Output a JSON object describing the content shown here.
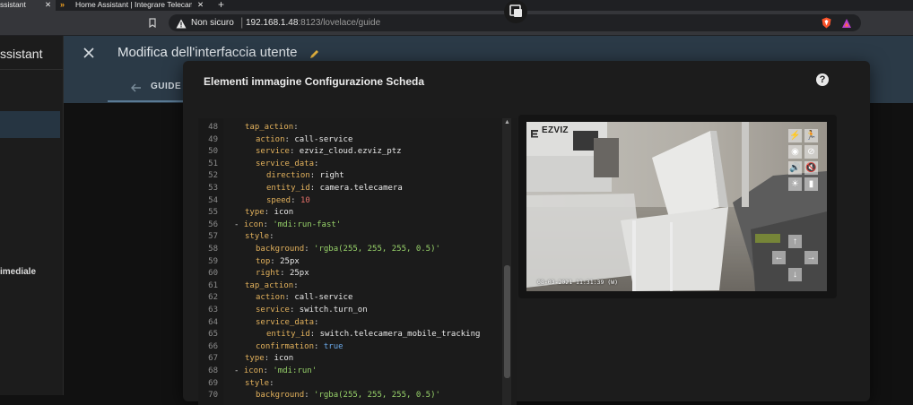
{
  "browser": {
    "tabs": [
      {
        "label": "ssistant",
        "close": "✕"
      },
      {
        "label": "Home Assistant | Integrare Telecamere",
        "close": "✕"
      }
    ],
    "new_tab": "+",
    "security_label": "Non sicuro",
    "url_host": "192.168.1.48",
    "url_path": ":8123/lovelace/guide"
  },
  "ha": {
    "sidebar_title": "ssistant",
    "sidebar_item": "imediale",
    "header_title": "Modifica dell'interfaccia utente",
    "tab_label": "GUIDE"
  },
  "dialog": {
    "title": "Elementi immagine Configurazione Scheda",
    "help": "?"
  },
  "editor": {
    "lines": [
      {
        "n": "48",
        "i": 2,
        "segs": [
          [
            "k",
            "tap_action"
          ],
          [
            "p",
            ":"
          ]
        ]
      },
      {
        "n": "49",
        "i": 3,
        "segs": [
          [
            "k",
            "action"
          ],
          [
            "p",
            ": "
          ],
          [
            "v",
            "call-service"
          ]
        ]
      },
      {
        "n": "50",
        "i": 3,
        "segs": [
          [
            "k",
            "service"
          ],
          [
            "p",
            ": "
          ],
          [
            "v",
            "ezviz_cloud.ezviz_ptz"
          ]
        ]
      },
      {
        "n": "51",
        "i": 3,
        "segs": [
          [
            "k",
            "service_data"
          ],
          [
            "p",
            ":"
          ]
        ]
      },
      {
        "n": "52",
        "i": 4,
        "segs": [
          [
            "k",
            "direction"
          ],
          [
            "p",
            ": "
          ],
          [
            "v",
            "right"
          ]
        ]
      },
      {
        "n": "53",
        "i": 4,
        "segs": [
          [
            "k",
            "entity_id"
          ],
          [
            "p",
            ": "
          ],
          [
            "v",
            "camera.telecamera"
          ]
        ]
      },
      {
        "n": "54",
        "i": 4,
        "segs": [
          [
            "k",
            "speed"
          ],
          [
            "p",
            ": "
          ],
          [
            "n",
            "10"
          ]
        ]
      },
      {
        "n": "55",
        "i": 2,
        "segs": [
          [
            "k",
            "type"
          ],
          [
            "p",
            ": "
          ],
          [
            "v",
            "icon"
          ]
        ]
      },
      {
        "n": "56",
        "i": 1,
        "segs": [
          [
            "p",
            "- "
          ],
          [
            "k",
            "icon"
          ],
          [
            "p",
            ": "
          ],
          [
            "s",
            "'mdi:run-fast'"
          ]
        ]
      },
      {
        "n": "57",
        "i": 2,
        "segs": [
          [
            "k",
            "style"
          ],
          [
            "p",
            ":"
          ]
        ]
      },
      {
        "n": "58",
        "i": 3,
        "segs": [
          [
            "k",
            "background"
          ],
          [
            "p",
            ": "
          ],
          [
            "s",
            "'rgba(255, 255, 255, 0.5)'"
          ]
        ]
      },
      {
        "n": "59",
        "i": 3,
        "segs": [
          [
            "k",
            "top"
          ],
          [
            "p",
            ": "
          ],
          [
            "v",
            "25px"
          ]
        ]
      },
      {
        "n": "60",
        "i": 3,
        "segs": [
          [
            "k",
            "right"
          ],
          [
            "p",
            ": "
          ],
          [
            "v",
            "25px"
          ]
        ]
      },
      {
        "n": "61",
        "i": 2,
        "segs": [
          [
            "k",
            "tap_action"
          ],
          [
            "p",
            ":"
          ]
        ]
      },
      {
        "n": "62",
        "i": 3,
        "segs": [
          [
            "k",
            "action"
          ],
          [
            "p",
            ": "
          ],
          [
            "v",
            "call-service"
          ]
        ]
      },
      {
        "n": "63",
        "i": 3,
        "segs": [
          [
            "k",
            "service"
          ],
          [
            "p",
            ": "
          ],
          [
            "v",
            "switch.turn_on"
          ]
        ]
      },
      {
        "n": "64",
        "i": 3,
        "segs": [
          [
            "k",
            "service_data"
          ],
          [
            "p",
            ":"
          ]
        ]
      },
      {
        "n": "65",
        "i": 4,
        "segs": [
          [
            "k",
            "entity_id"
          ],
          [
            "p",
            ": "
          ],
          [
            "v",
            "switch.telecamera_mobile_tracking"
          ]
        ]
      },
      {
        "n": "66",
        "i": 3,
        "segs": [
          [
            "k",
            "confirmation"
          ],
          [
            "p",
            ": "
          ],
          [
            "b",
            "true"
          ]
        ]
      },
      {
        "n": "67",
        "i": 2,
        "segs": [
          [
            "k",
            "type"
          ],
          [
            "p",
            ": "
          ],
          [
            "v",
            "icon"
          ]
        ]
      },
      {
        "n": "68",
        "i": 1,
        "segs": [
          [
            "p",
            "- "
          ],
          [
            "k",
            "icon"
          ],
          [
            "p",
            ": "
          ],
          [
            "s",
            "'mdi:run'"
          ]
        ]
      },
      {
        "n": "69",
        "i": 2,
        "segs": [
          [
            "k",
            "style"
          ],
          [
            "p",
            ":"
          ]
        ]
      },
      {
        "n": "70",
        "i": 3,
        "segs": [
          [
            "k",
            "background"
          ],
          [
            "p",
            ": "
          ],
          [
            "s",
            "'rgba(255, 255, 255, 0.5)'"
          ]
        ]
      }
    ]
  },
  "camera": {
    "brand": "EZVIZ",
    "timestamp": "08-03-2021 11:31:39 (W)",
    "controls": [
      {
        "name": "run-fast-icon",
        "glyph": "⚡"
      },
      {
        "name": "run-icon",
        "glyph": "🏃"
      },
      {
        "name": "eye-icon",
        "glyph": "◉"
      },
      {
        "name": "eye-off-icon",
        "glyph": "⊘"
      },
      {
        "name": "volume-high-icon",
        "glyph": "🔊"
      },
      {
        "name": "volume-off-icon",
        "glyph": "🔇"
      },
      {
        "name": "brightness-icon",
        "glyph": "☀"
      },
      {
        "name": "led-icon",
        "glyph": "▮"
      }
    ],
    "ptz": {
      "up": "↑",
      "left": "←",
      "right": "→",
      "down": "↓"
    }
  }
}
